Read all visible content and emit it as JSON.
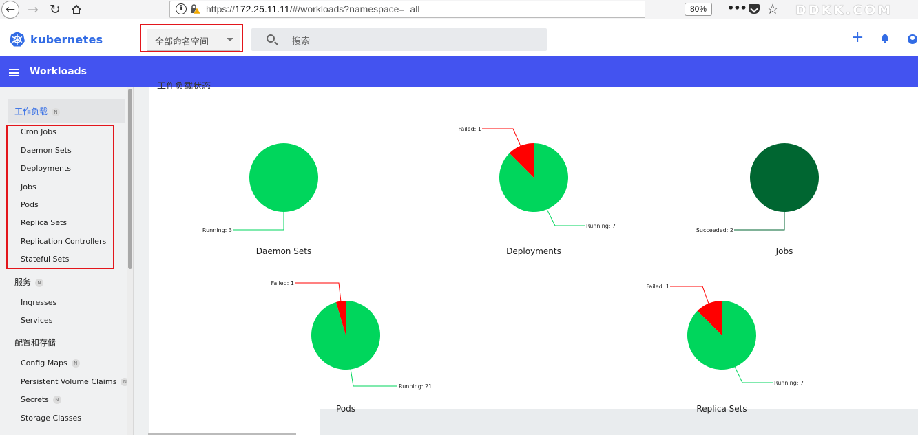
{
  "browser": {
    "url_prefix": "https://",
    "url_host": "172.25.11.11",
    "url_path": "/#/workloads?namespace=_all",
    "zoom": "80%",
    "page_actions": "•••",
    "watermark": "DDKK.COM"
  },
  "header": {
    "brand": "kubernetes",
    "namespace_selected": "全部命名空间",
    "search_placeholder": "搜索"
  },
  "toolbar": {
    "title": "Workloads"
  },
  "sidebar": {
    "workloads_heading": "工作负载",
    "workloads_badge": "N",
    "workload_items": [
      "Cron Jobs",
      "Daemon Sets",
      "Deployments",
      "Jobs",
      "Pods",
      "Replica Sets",
      "Replication Controllers",
      "Stateful Sets"
    ],
    "services_heading": "服务",
    "services_badge": "N",
    "services_items": [
      "Ingresses",
      "Services"
    ],
    "config_heading": "配置和存储",
    "config_items": [
      {
        "label": "Config Maps",
        "badge": "N"
      },
      {
        "label": "Persistent Volume Claims",
        "badge": "N"
      },
      {
        "label": "Secrets",
        "badge": "N"
      },
      {
        "label": "Storage Classes",
        "badge": ""
      }
    ]
  },
  "main": {
    "section_title": "工作负载状态"
  },
  "colors": {
    "running": "#00d65c",
    "failed": "#ff0000",
    "succeeded": "#006631",
    "accent": "#326ce5",
    "toolbar": "#4353f0"
  },
  "chart_data": [
    {
      "type": "pie",
      "title": "Daemon Sets",
      "slices": [
        {
          "label": "Running: 3",
          "name": "Running",
          "value": 3,
          "color": "#00d65c"
        }
      ]
    },
    {
      "type": "pie",
      "title": "Deployments",
      "slices": [
        {
          "label": "Failed: 1",
          "name": "Failed",
          "value": 1,
          "color": "#ff0000"
        },
        {
          "label": "Running: 7",
          "name": "Running",
          "value": 7,
          "color": "#00d65c"
        }
      ]
    },
    {
      "type": "pie",
      "title": "Jobs",
      "slices": [
        {
          "label": "Succeeded: 2",
          "name": "Succeeded",
          "value": 2,
          "color": "#006631"
        }
      ]
    },
    {
      "type": "pie",
      "title": "Pods",
      "slices": [
        {
          "label": "Failed: 1",
          "name": "Failed",
          "value": 1,
          "color": "#ff0000"
        },
        {
          "label": "Running: 21",
          "name": "Running",
          "value": 21,
          "color": "#00d65c"
        }
      ]
    },
    {
      "type": "pie",
      "title": "Replica Sets",
      "slices": [
        {
          "label": "Failed: 1",
          "name": "Failed",
          "value": 1,
          "color": "#ff0000"
        },
        {
          "label": "Running: 7",
          "name": "Running",
          "value": 7,
          "color": "#00d65c"
        }
      ]
    }
  ]
}
